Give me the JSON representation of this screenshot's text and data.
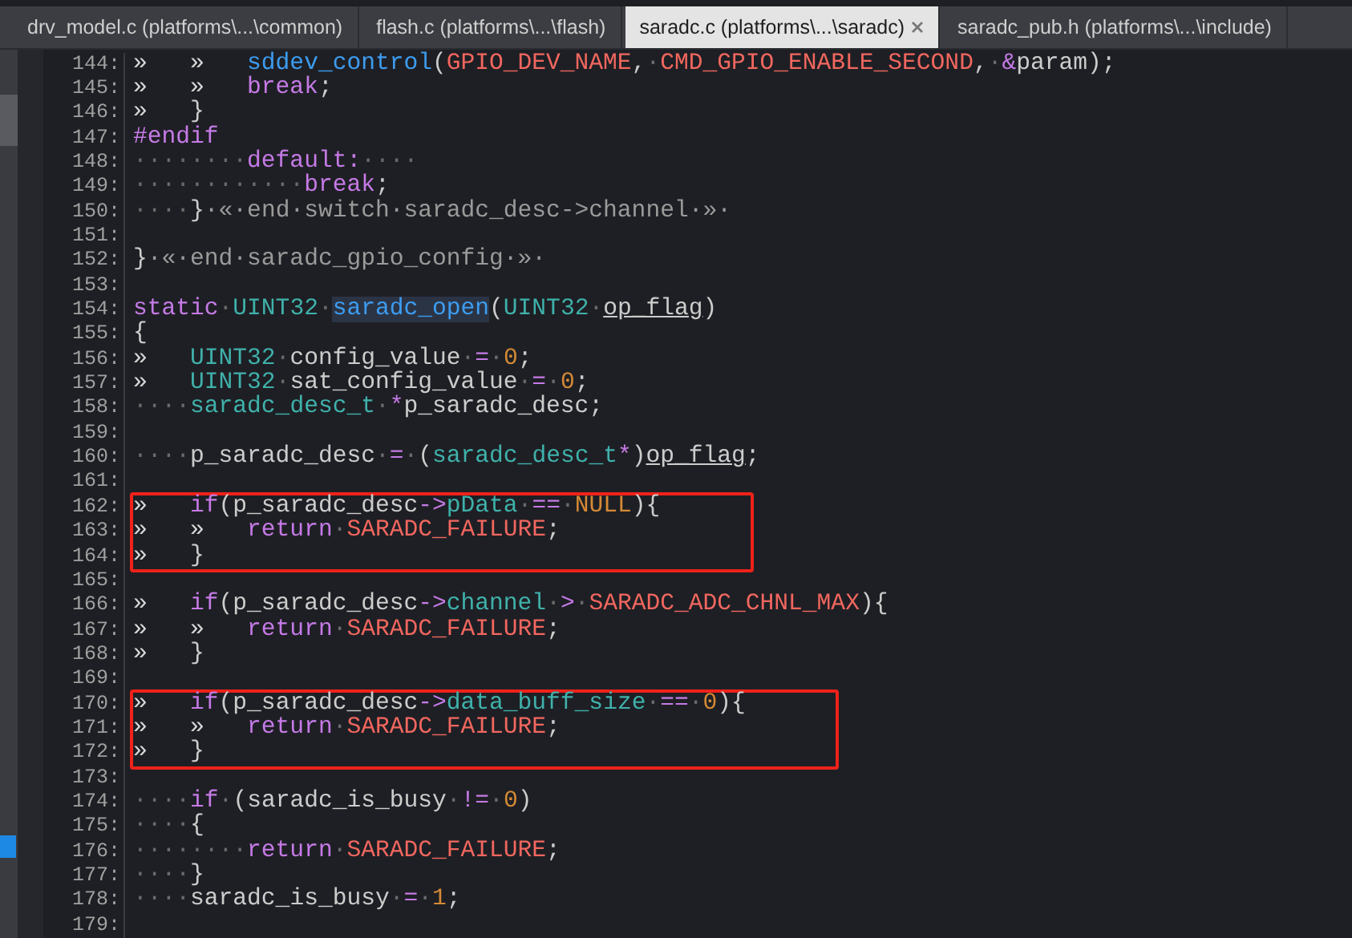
{
  "tabs": [
    {
      "label": "drv_model.c (platforms\\...\\common)",
      "selected": false
    },
    {
      "label": "flash.c (platforms\\...\\flash)",
      "selected": false
    },
    {
      "label": "saradc.c (platforms\\...\\saradc)",
      "selected": true
    },
    {
      "label": "saradc_pub.h (platforms\\...\\include)",
      "selected": false
    }
  ],
  "blocks": [
    {
      "boxed": false,
      "lines": [
        {
          "number": "144:",
          "tokens": [
            {
              "text": "»   »   ",
              "kind": "tab"
            },
            {
              "text": "sddev_control",
              "kind": "fn"
            },
            {
              "text": "(",
              "kind": "p"
            },
            {
              "text": "GPIO_DEV_NAME",
              "kind": "macro"
            },
            {
              "text": ",",
              "kind": "p"
            },
            {
              "text": "·",
              "kind": "ws"
            },
            {
              "text": "CMD_GPIO_ENABLE_SECOND",
              "kind": "macro"
            },
            {
              "text": ",",
              "kind": "p"
            },
            {
              "text": "·",
              "kind": "ws"
            },
            {
              "text": "&",
              "kind": "kw"
            },
            {
              "text": "param);",
              "kind": "p"
            }
          ]
        },
        {
          "number": "145:",
          "tokens": [
            {
              "text": "»   »   ",
              "kind": "tab"
            },
            {
              "text": "break",
              "kind": "kw"
            },
            {
              "text": ";",
              "kind": "p"
            }
          ]
        },
        {
          "number": "146:",
          "tokens": [
            {
              "text": "»   ",
              "kind": "tab"
            },
            {
              "text": "}",
              "kind": "p"
            }
          ]
        },
        {
          "number": "147:",
          "tokens": [
            {
              "text": "#endif",
              "kind": "kw"
            }
          ]
        },
        {
          "number": "148:",
          "tokens": [
            {
              "text": "········",
              "kind": "ws"
            },
            {
              "text": "default:",
              "kind": "kw"
            },
            {
              "text": "····",
              "kind": "ws"
            }
          ]
        },
        {
          "number": "149:",
          "tokens": [
            {
              "text": "············",
              "kind": "ws"
            },
            {
              "text": "break",
              "kind": "kw"
            },
            {
              "text": ";",
              "kind": "p"
            }
          ]
        },
        {
          "number": "150:",
          "tokens": [
            {
              "text": "····",
              "kind": "ws"
            },
            {
              "text": "}",
              "kind": "p"
            },
            {
              "text": "·«·end·switch·saradc_desc->channel·»·",
              "kind": "cm"
            }
          ]
        },
        {
          "number": "151:"
        },
        {
          "number": "152:",
          "tokens": [
            {
              "text": "}",
              "kind": "p"
            },
            {
              "text": "·«·end·saradc_gpio_config·»·",
              "kind": "cm"
            }
          ]
        },
        {
          "number": "153:"
        },
        {
          "number": "154:",
          "tokens": [
            {
              "text": "static",
              "kind": "kw"
            },
            {
              "text": "·",
              "kind": "ws"
            },
            {
              "text": "UINT32",
              "kind": "type"
            },
            {
              "text": "·",
              "kind": "ws"
            },
            {
              "text": "saradc_open",
              "kind": "hl"
            },
            {
              "text": "(",
              "kind": "p"
            },
            {
              "text": "UINT32",
              "kind": "type"
            },
            {
              "text": "·",
              "kind": "ws"
            },
            {
              "text": "op_flag",
              "kind": "ul"
            },
            {
              "text": ")",
              "kind": "p"
            }
          ]
        },
        {
          "number": "155:",
          "tokens": [
            {
              "text": "{",
              "kind": "p"
            }
          ]
        },
        {
          "number": "156:",
          "tokens": [
            {
              "text": "»   ",
              "kind": "tab"
            },
            {
              "text": "UINT32",
              "kind": "type"
            },
            {
              "text": "·",
              "kind": "ws"
            },
            {
              "text": "config_value",
              "kind": "p"
            },
            {
              "text": "·",
              "kind": "ws"
            },
            {
              "text": "=",
              "kind": "kw"
            },
            {
              "text": "·",
              "kind": "ws"
            },
            {
              "text": "0",
              "kind": "num"
            },
            {
              "text": ";",
              "kind": "p"
            }
          ]
        },
        {
          "number": "157:",
          "tokens": [
            {
              "text": "»   ",
              "kind": "tab"
            },
            {
              "text": "UINT32",
              "kind": "type"
            },
            {
              "text": "·",
              "kind": "ws"
            },
            {
              "text": "sat_config_value",
              "kind": "p"
            },
            {
              "text": "·",
              "kind": "ws"
            },
            {
              "text": "=",
              "kind": "kw"
            },
            {
              "text": "·",
              "kind": "ws"
            },
            {
              "text": "0",
              "kind": "num"
            },
            {
              "text": ";",
              "kind": "p"
            }
          ]
        },
        {
          "number": "158:",
          "tokens": [
            {
              "text": "····",
              "kind": "ws"
            },
            {
              "text": "saradc_desc_t",
              "kind": "type"
            },
            {
              "text": "·",
              "kind": "ws"
            },
            {
              "text": "*",
              "kind": "kw"
            },
            {
              "text": "p_saradc_desc;",
              "kind": "p"
            }
          ]
        },
        {
          "number": "159:"
        },
        {
          "number": "160:",
          "tokens": [
            {
              "text": "····",
              "kind": "ws"
            },
            {
              "text": "p_saradc_desc",
              "kind": "p"
            },
            {
              "text": "·",
              "kind": "ws"
            },
            {
              "text": "=",
              "kind": "kw"
            },
            {
              "text": "·",
              "kind": "ws"
            },
            {
              "text": "(",
              "kind": "p"
            },
            {
              "text": "saradc_desc_t",
              "kind": "type"
            },
            {
              "text": "*",
              "kind": "kw"
            },
            {
              "text": ")",
              "kind": "p"
            },
            {
              "text": "op_flag",
              "kind": "ul"
            },
            {
              "text": ";",
              "kind": "p"
            }
          ]
        },
        {
          "number": "161:"
        }
      ]
    },
    {
      "boxed": true,
      "lines": [
        {
          "number": "162:",
          "tokens": [
            {
              "text": "»   ",
              "kind": "tab"
            },
            {
              "text": "if",
              "kind": "kw"
            },
            {
              "text": "(p_saradc_desc",
              "kind": "p"
            },
            {
              "text": "->",
              "kind": "kw"
            },
            {
              "text": "pData",
              "kind": "type"
            },
            {
              "text": "·",
              "kind": "ws"
            },
            {
              "text": "==",
              "kind": "kw"
            },
            {
              "text": "·",
              "kind": "ws"
            },
            {
              "text": "NULL",
              "kind": "num"
            },
            {
              "text": "){",
              "kind": "p"
            }
          ]
        },
        {
          "number": "163:",
          "tokens": [
            {
              "text": "»   »   ",
              "kind": "tab"
            },
            {
              "text": "return",
              "kind": "kw"
            },
            {
              "text": "·",
              "kind": "ws"
            },
            {
              "text": "SARADC_FAILURE",
              "kind": "macro"
            },
            {
              "text": ";",
              "kind": "p"
            }
          ]
        },
        {
          "number": "164:",
          "tokens": [
            {
              "text": "»   ",
              "kind": "tab"
            },
            {
              "text": "}",
              "kind": "p"
            }
          ]
        }
      ]
    },
    {
      "boxed": false,
      "lines": [
        {
          "number": "165:"
        },
        {
          "number": "166:",
          "tokens": [
            {
              "text": "»   ",
              "kind": "tab"
            },
            {
              "text": "if",
              "kind": "kw"
            },
            {
              "text": "(p_saradc_desc",
              "kind": "p"
            },
            {
              "text": "->",
              "kind": "kw"
            },
            {
              "text": "channel",
              "kind": "type"
            },
            {
              "text": "·",
              "kind": "ws"
            },
            {
              "text": ">",
              "kind": "kw"
            },
            {
              "text": "·",
              "kind": "ws"
            },
            {
              "text": "SARADC_ADC_CHNL_MAX",
              "kind": "macro"
            },
            {
              "text": "){",
              "kind": "p"
            }
          ]
        },
        {
          "number": "167:",
          "tokens": [
            {
              "text": "»   »   ",
              "kind": "tab"
            },
            {
              "text": "return",
              "kind": "kw"
            },
            {
              "text": "·",
              "kind": "ws"
            },
            {
              "text": "SARADC_FAILURE",
              "kind": "macro"
            },
            {
              "text": ";",
              "kind": "p"
            }
          ]
        },
        {
          "number": "168:",
          "tokens": [
            {
              "text": "»   ",
              "kind": "tab"
            },
            {
              "text": "}",
              "kind": "p"
            }
          ]
        },
        {
          "number": "169:"
        }
      ]
    },
    {
      "boxed": true,
      "lines": [
        {
          "number": "170:",
          "tokens": [
            {
              "text": "»   ",
              "kind": "tab"
            },
            {
              "text": "if",
              "kind": "kw"
            },
            {
              "text": "(p_saradc_desc",
              "kind": "p"
            },
            {
              "text": "->",
              "kind": "kw"
            },
            {
              "text": "data_buff_size",
              "kind": "type"
            },
            {
              "text": "·",
              "kind": "ws"
            },
            {
              "text": "==",
              "kind": "kw"
            },
            {
              "text": "·",
              "kind": "ws"
            },
            {
              "text": "0",
              "kind": "num"
            },
            {
              "text": "){",
              "kind": "p"
            }
          ]
        },
        {
          "number": "171:",
          "tokens": [
            {
              "text": "»   »   ",
              "kind": "tab"
            },
            {
              "text": "return",
              "kind": "kw"
            },
            {
              "text": "·",
              "kind": "ws"
            },
            {
              "text": "SARADC_FAILURE",
              "kind": "macro"
            },
            {
              "text": ";",
              "kind": "p"
            }
          ]
        },
        {
          "number": "172:",
          "tokens": [
            {
              "text": "»   ",
              "kind": "tab"
            },
            {
              "text": "}",
              "kind": "p"
            }
          ]
        }
      ]
    },
    {
      "boxed": false,
      "lines": [
        {
          "number": "173:"
        },
        {
          "number": "174:",
          "tokens": [
            {
              "text": "····",
              "kind": "ws"
            },
            {
              "text": "if",
              "kind": "kw"
            },
            {
              "text": "·",
              "kind": "ws"
            },
            {
              "text": "(saradc_is_busy",
              "kind": "p"
            },
            {
              "text": "·",
              "kind": "ws"
            },
            {
              "text": "!=",
              "kind": "kw"
            },
            {
              "text": "·",
              "kind": "ws"
            },
            {
              "text": "0",
              "kind": "num"
            },
            {
              "text": ")",
              "kind": "p"
            }
          ]
        },
        {
          "number": "175:",
          "tokens": [
            {
              "text": "····",
              "kind": "ws"
            },
            {
              "text": "{",
              "kind": "p"
            }
          ]
        },
        {
          "number": "176:",
          "tokens": [
            {
              "text": "········",
              "kind": "ws"
            },
            {
              "text": "return",
              "kind": "kw"
            },
            {
              "text": "·",
              "kind": "ws"
            },
            {
              "text": "SARADC_FAILURE",
              "kind": "macro"
            },
            {
              "text": ";",
              "kind": "p"
            }
          ]
        },
        {
          "number": "177:",
          "tokens": [
            {
              "text": "····",
              "kind": "ws"
            },
            {
              "text": "}",
              "kind": "p"
            }
          ]
        },
        {
          "number": "178:",
          "tokens": [
            {
              "text": "····",
              "kind": "ws"
            },
            {
              "text": "saradc_is_busy",
              "kind": "p"
            },
            {
              "text": "·",
              "kind": "ws"
            },
            {
              "text": "=",
              "kind": "kw"
            },
            {
              "text": "·",
              "kind": "ws"
            },
            {
              "text": "1",
              "kind": "num"
            },
            {
              "text": ";",
              "kind": "p"
            }
          ]
        },
        {
          "number": "179:"
        }
      ]
    }
  ]
}
